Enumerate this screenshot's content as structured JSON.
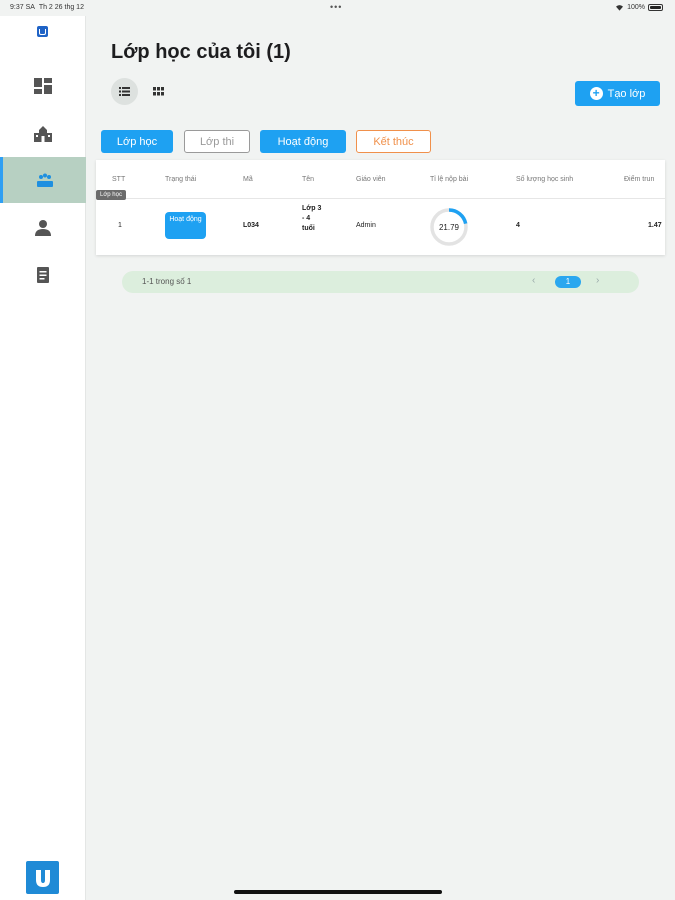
{
  "status_bar": {
    "time": "9:37 SA",
    "date": "Th 2 26 thg 12",
    "battery": "100%"
  },
  "sidebar": {
    "items": [
      {
        "icon": "dashboard-icon"
      },
      {
        "icon": "school-icon"
      },
      {
        "icon": "classroom-icon",
        "active": true
      },
      {
        "icon": "person-icon"
      },
      {
        "icon": "document-icon"
      }
    ],
    "tooltip": "Lớp học"
  },
  "page": {
    "title": "Lớp học của tôi (1)",
    "create_button": "Tạo lớp"
  },
  "filters": {
    "lop_hoc": "Lớp học",
    "lop_thi": "Lớp thi",
    "hoat_dong": "Hoạt động",
    "ket_thuc": "Kết thúc"
  },
  "table": {
    "headers": [
      "STT",
      "Trạng thái",
      "Mã",
      "Tên",
      "Giáo viên",
      "Tỉ lệ nộp bài",
      "Số lượng học sinh",
      "Điểm trun"
    ],
    "rows": [
      {
        "stt": "1",
        "status": "Hoạt động",
        "code": "L034",
        "name": "Lớp 3 - 4 tuổi",
        "teacher": "Admin",
        "submit_rate": "21.79",
        "submit_fraction": 0.2179,
        "students": "4",
        "score": "1.47"
      }
    ]
  },
  "pagination": {
    "info": "1-1 trong số 1",
    "current_page": "1"
  },
  "colors": {
    "primary": "#1ea1f2",
    "finished": "#f0904b",
    "active_nav": "#b7d0c2"
  }
}
